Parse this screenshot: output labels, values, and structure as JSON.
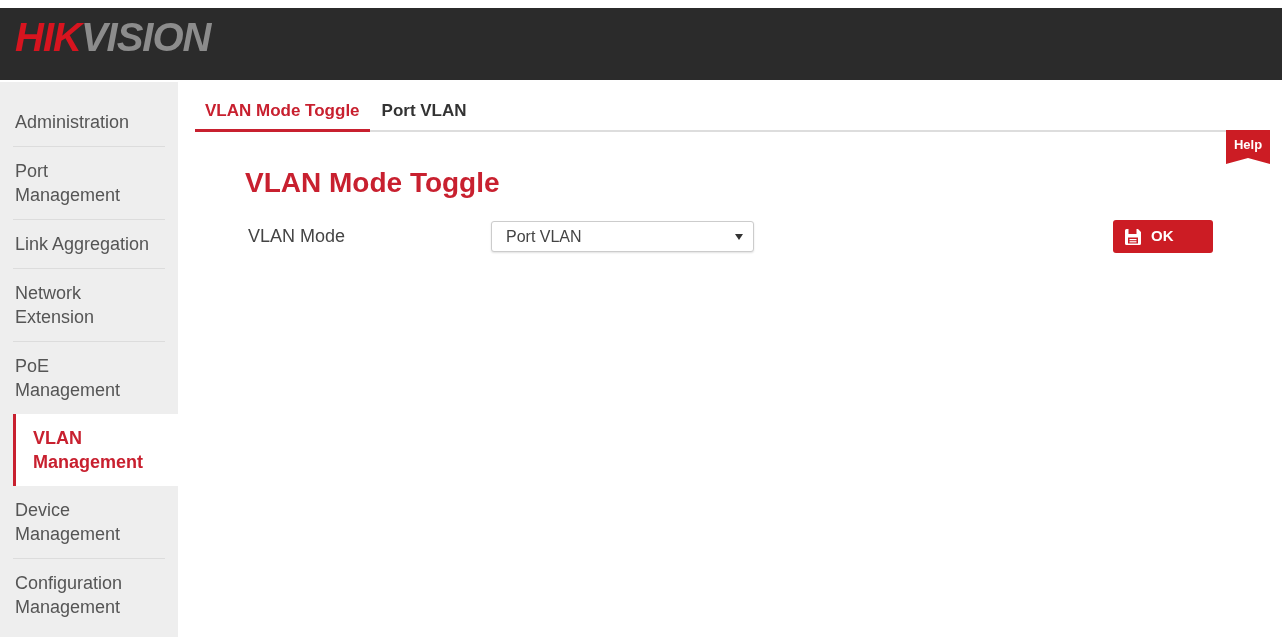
{
  "header": {
    "logo": {
      "accent": "HIK",
      "text": "VISION"
    }
  },
  "sidebar": {
    "items": [
      {
        "label": "Administration",
        "selected": false
      },
      {
        "label": "Port\nManagement",
        "selected": false
      },
      {
        "label": "Link Aggregation",
        "selected": false
      },
      {
        "label": "Network\nExtension",
        "selected": false
      },
      {
        "label": "PoE\nManagement",
        "selected": false
      },
      {
        "label": "VLAN\nManagement",
        "selected": true
      },
      {
        "label": "Device\nManagement",
        "selected": false
      },
      {
        "label": "Configuration\nManagement",
        "selected": false
      }
    ]
  },
  "tabs": [
    {
      "label": "VLAN Mode Toggle",
      "selected": true
    },
    {
      "label": "Port VLAN",
      "selected": false
    }
  ],
  "help_button": {
    "label": "Help"
  },
  "section": {
    "title": "VLAN Mode Toggle",
    "vlan_mode": {
      "label": "VLAN Mode",
      "value": "Port VLAN"
    }
  },
  "ok_button": {
    "label": "OK"
  }
}
